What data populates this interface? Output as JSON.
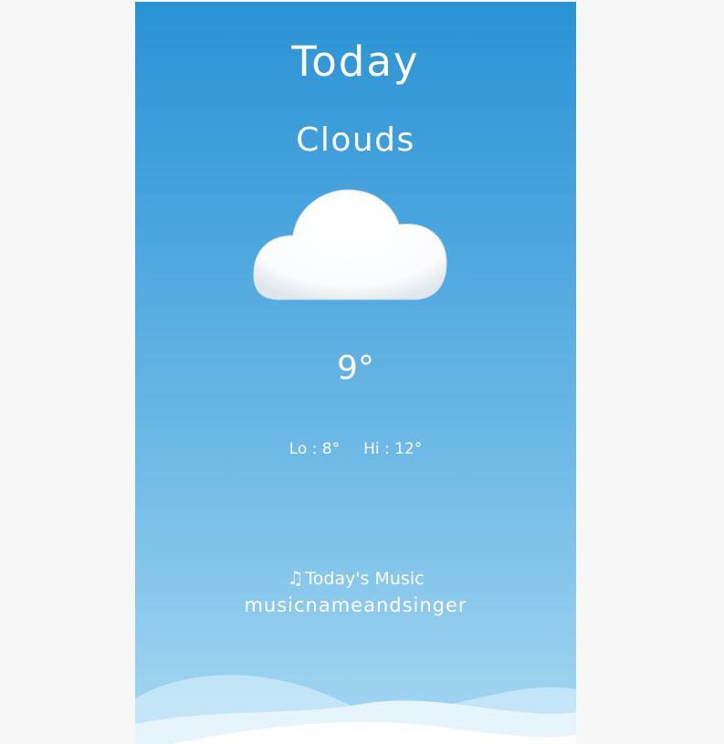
{
  "header": {
    "title": "Today"
  },
  "weather": {
    "condition": "Clouds",
    "icon": "cloud-icon",
    "temperature": "9°",
    "lo": "Lo : 8°",
    "hi": "Hi : 12°"
  },
  "music": {
    "icon": "music-note-icon",
    "title": "Today's Music",
    "name": "musicnameandsinger"
  },
  "colors": {
    "sky_top": "#2a93d5",
    "sky_bottom": "#a6d8f2",
    "text": "#ffffff"
  }
}
